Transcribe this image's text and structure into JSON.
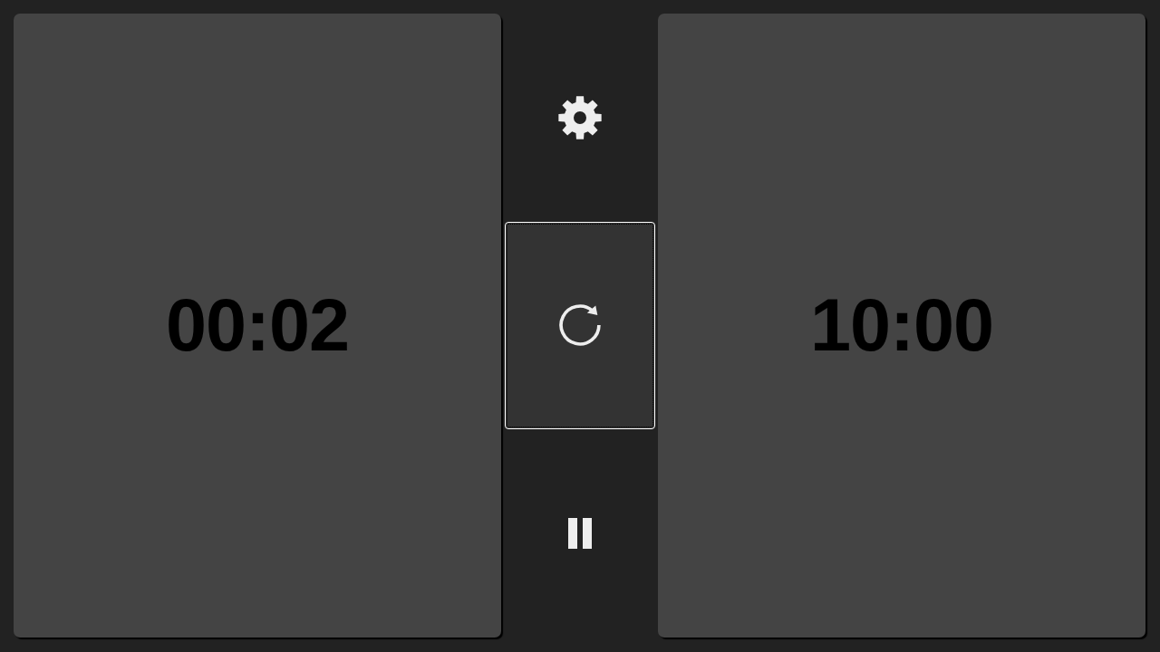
{
  "players": [
    {
      "time": "00:02"
    },
    {
      "time": "10:00"
    }
  ],
  "controls": [
    {
      "kind": "settings",
      "focused": false
    },
    {
      "kind": "reset",
      "focused": true
    },
    {
      "kind": "pause",
      "focused": false
    }
  ]
}
